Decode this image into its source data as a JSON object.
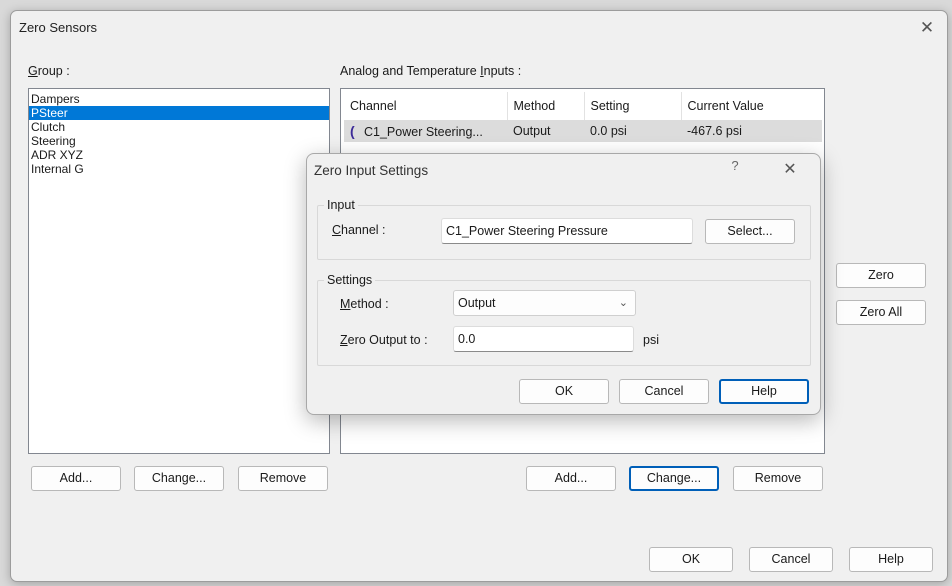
{
  "window": {
    "title": "Zero Sensors",
    "close_glyph": "✕"
  },
  "group": {
    "label_accel": "G",
    "label_rest": "roup :",
    "items": [
      {
        "label": "Dampers",
        "selected": false
      },
      {
        "label": "PSteer",
        "selected": true
      },
      {
        "label": "Clutch",
        "selected": false
      },
      {
        "label": "Steering",
        "selected": false
      },
      {
        "label": "ADR XYZ",
        "selected": false
      },
      {
        "label": "Internal G",
        "selected": false
      }
    ],
    "buttons": {
      "add": "Add...",
      "change": "Change...",
      "remove": "Remove"
    }
  },
  "inputs": {
    "label_pre": "Analog and Temperature ",
    "label_accel": "I",
    "label_post": "nputs :",
    "columns": [
      "Channel",
      "Method",
      "Setting",
      "Current Value"
    ],
    "rows": [
      {
        "icon": "channel-icon",
        "channel": "C1_Power Steering...",
        "method": "Output",
        "setting": "0.0 psi",
        "current": "-467.6 psi",
        "selected": true
      }
    ],
    "buttons": {
      "add": "Add...",
      "change": "Change...",
      "remove": "Remove"
    }
  },
  "side_buttons": {
    "zero": "Zero",
    "zero_all": "Zero All"
  },
  "footer": {
    "ok": "OK",
    "cancel": "Cancel",
    "help": "Help"
  },
  "dialog": {
    "title": "Zero Input Settings",
    "help_glyph": "?",
    "close_glyph": "✕",
    "input_group": "Input",
    "channel_label_accel": "C",
    "channel_label_rest": "hannel :",
    "channel_value": "C1_Power Steering Pressure",
    "select_button": "Select...",
    "settings_group": "Settings",
    "method_label_accel": "M",
    "method_label_rest": "ethod :",
    "method_value": "Output",
    "zero_label_accel": "Z",
    "zero_label_rest": "ero Output to :",
    "zero_value": "0.0",
    "unit": "psi",
    "ok": "OK",
    "cancel": "Cancel",
    "help": "Help"
  }
}
